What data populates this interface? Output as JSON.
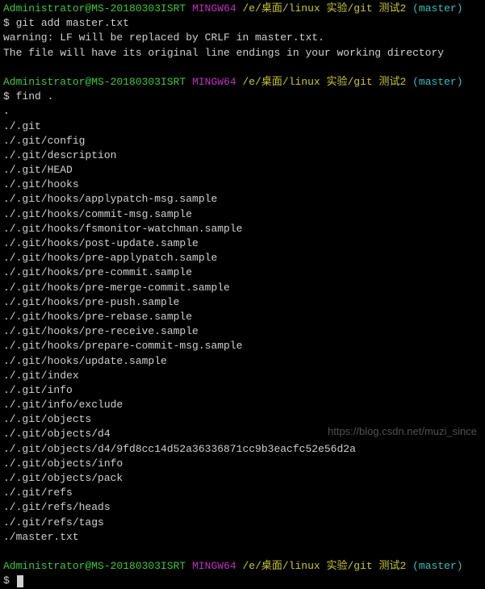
{
  "prompts": [
    {
      "user": "Administrator@MS-20180303ISRT",
      "shell": "MINGW64",
      "path": "/e/桌面/linux 实验/git 测试2",
      "branch": "(master)",
      "command": "git add master.txt",
      "output": [
        "warning: LF will be replaced by CRLF in master.txt.",
        "The file will have its original line endings in your working directory"
      ]
    },
    {
      "user": "Administrator@MS-20180303ISRT",
      "shell": "MINGW64",
      "path": "/e/桌面/linux 实验/git 测试2",
      "branch": "(master)",
      "command": "find .",
      "output": [
        ".",
        "./.git",
        "./.git/config",
        "./.git/description",
        "./.git/HEAD",
        "./.git/hooks",
        "./.git/hooks/applypatch-msg.sample",
        "./.git/hooks/commit-msg.sample",
        "./.git/hooks/fsmonitor-watchman.sample",
        "./.git/hooks/post-update.sample",
        "./.git/hooks/pre-applypatch.sample",
        "./.git/hooks/pre-commit.sample",
        "./.git/hooks/pre-merge-commit.sample",
        "./.git/hooks/pre-push.sample",
        "./.git/hooks/pre-rebase.sample",
        "./.git/hooks/pre-receive.sample",
        "./.git/hooks/prepare-commit-msg.sample",
        "./.git/hooks/update.sample",
        "./.git/index",
        "./.git/info",
        "./.git/info/exclude",
        "./.git/objects",
        "./.git/objects/d4",
        "./.git/objects/d4/9fd8cc14d52a36336871cc9b3eacfc52e56d2a",
        "./.git/objects/info",
        "./.git/objects/pack",
        "./.git/refs",
        "./.git/refs/heads",
        "./.git/refs/tags",
        "./master.txt"
      ]
    },
    {
      "user": "Administrator@MS-20180303ISRT",
      "shell": "MINGW64",
      "path": "/e/桌面/linux 实验/git 测试2",
      "branch": "(master)",
      "command": "",
      "output": []
    }
  ],
  "prompt_symbol": "$",
  "watermark": "https://blog.csdn.net/muzi_since"
}
